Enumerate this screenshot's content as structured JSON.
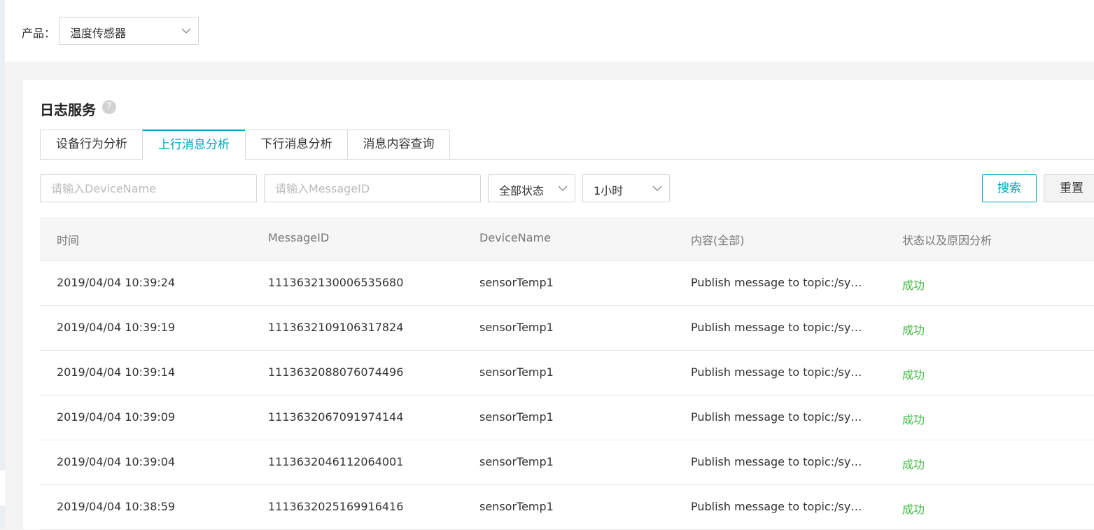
{
  "filter": {
    "product_label": "产品：",
    "product_value": "温度传感器"
  },
  "log_service": {
    "title": "日志服务",
    "help_icon": "?"
  },
  "tabs": [
    {
      "label": "设备行为分析",
      "active": false
    },
    {
      "label": "上行消息分析",
      "active": true
    },
    {
      "label": "下行消息分析",
      "active": false
    },
    {
      "label": "消息内容查询",
      "active": false
    }
  ],
  "search": {
    "device_placeholder": "请输入DeviceName",
    "message_placeholder": "请输入MessageID",
    "status_value": "全部状态",
    "time_value": "1小时",
    "search_label": "搜索",
    "reset_label": "重置"
  },
  "table": {
    "headers": [
      "时间",
      "MessageID",
      "DeviceName",
      "内容(全部)",
      "状态以及原因分析"
    ],
    "rows": [
      {
        "time": "2019/04/04 10:39:24",
        "message_id": "1113632130006535680",
        "device": "sensorTemp1",
        "content": "Publish message to topic:/sys…",
        "status": "成功"
      },
      {
        "time": "2019/04/04 10:39:19",
        "message_id": "1113632109106317824",
        "device": "sensorTemp1",
        "content": "Publish message to topic:/sys…",
        "status": "成功"
      },
      {
        "time": "2019/04/04 10:39:14",
        "message_id": "1113632088076074496",
        "device": "sensorTemp1",
        "content": "Publish message to topic:/sys…",
        "status": "成功"
      },
      {
        "time": "2019/04/04 10:39:09",
        "message_id": "1113632067091974144",
        "device": "sensorTemp1",
        "content": "Publish message to topic:/sys…",
        "status": "成功"
      },
      {
        "time": "2019/04/04 10:39:04",
        "message_id": "1113632046112064001",
        "device": "sensorTemp1",
        "content": "Publish message to topic:/sys…",
        "status": "成功"
      },
      {
        "time": "2019/04/04 10:38:59",
        "message_id": "1113632025169916416",
        "device": "sensorTemp1",
        "content": "Publish message to topic:/sys…",
        "status": "成功"
      }
    ]
  },
  "colors": {
    "accent": "#00a4c3",
    "success": "#3fba3f"
  }
}
